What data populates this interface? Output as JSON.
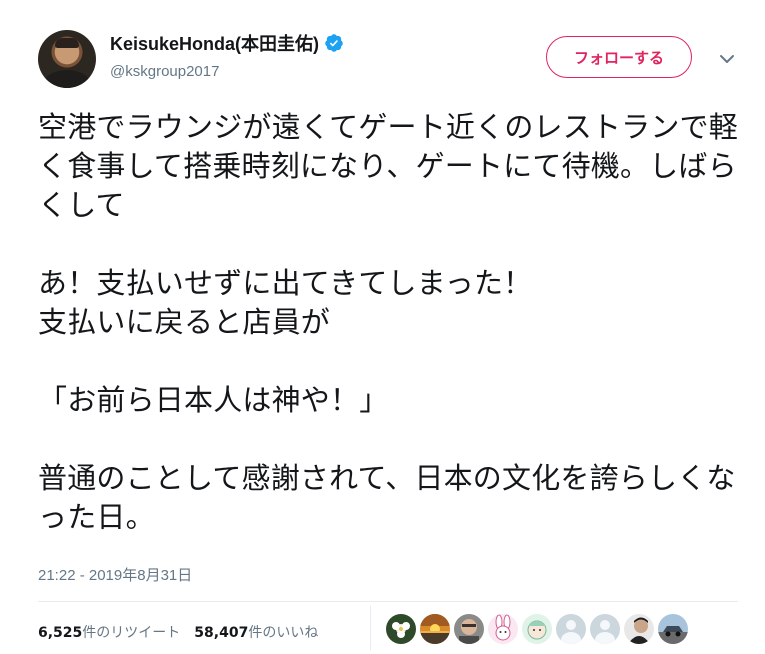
{
  "user": {
    "display_name": "KeisukeHonda(本田圭佑)",
    "handle": "@kskgroup2017",
    "verified": true
  },
  "follow_button": {
    "label": "フォローする",
    "color": "#e0245e"
  },
  "tweet": {
    "text": "空港でラウンジが遠くてゲート近くのレストランで軽く食事して搭乗時刻になり、ゲートにて待機。しばらくして\n\nあ！支払いせずに出てきてしまった！\n支払いに戻ると店員が\n\n「お前ら日本人は神や！」\n\n普通のことして感謝されて、日本の文化を誇らしくなった日。",
    "timestamp": "21:22 - 2019年8月31日"
  },
  "stats": {
    "retweets": {
      "count": "6,525",
      "label": "件のリツイート"
    },
    "likes": {
      "count": "58,407",
      "label": "件のいいね"
    }
  },
  "likers": [
    {
      "name": "liker-flower-avatar"
    },
    {
      "name": "liker-sunset-avatar"
    },
    {
      "name": "liker-person-avatar"
    },
    {
      "name": "liker-rabbit-avatar"
    },
    {
      "name": "liker-anime-avatar"
    },
    {
      "name": "liker-default-avatar"
    },
    {
      "name": "liker-default-avatar"
    },
    {
      "name": "liker-man-avatar"
    },
    {
      "name": "liker-car-avatar"
    }
  ],
  "colors": {
    "text": "#14171a",
    "secondary": "#657786",
    "verified": "#1da1f2",
    "divider": "#e6ecf0"
  },
  "icons": {
    "verified": "verified-badge-icon",
    "caret": "chevron-down-icon"
  }
}
